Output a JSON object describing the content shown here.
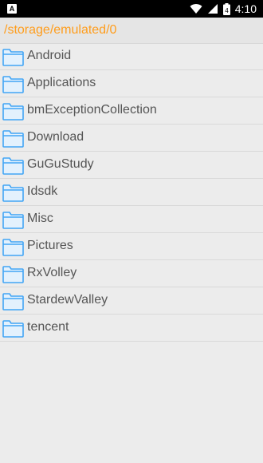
{
  "status_bar": {
    "notification_badge": "A",
    "time": "4:10",
    "battery_level": "4"
  },
  "path": "/storage/emulated/0",
  "colors": {
    "path_accent": "#ff9d1c",
    "folder_stroke": "#42a5f5",
    "folder_fill": "#e3f1fd"
  },
  "folders": [
    {
      "label": "Android"
    },
    {
      "label": "Applications"
    },
    {
      "label": "bmExceptionCollection"
    },
    {
      "label": "Download"
    },
    {
      "label": "GuGuStudy"
    },
    {
      "label": "Idsdk"
    },
    {
      "label": "Misc"
    },
    {
      "label": "Pictures"
    },
    {
      "label": "RxVolley"
    },
    {
      "label": "StardewValley"
    },
    {
      "label": "tencent"
    }
  ]
}
